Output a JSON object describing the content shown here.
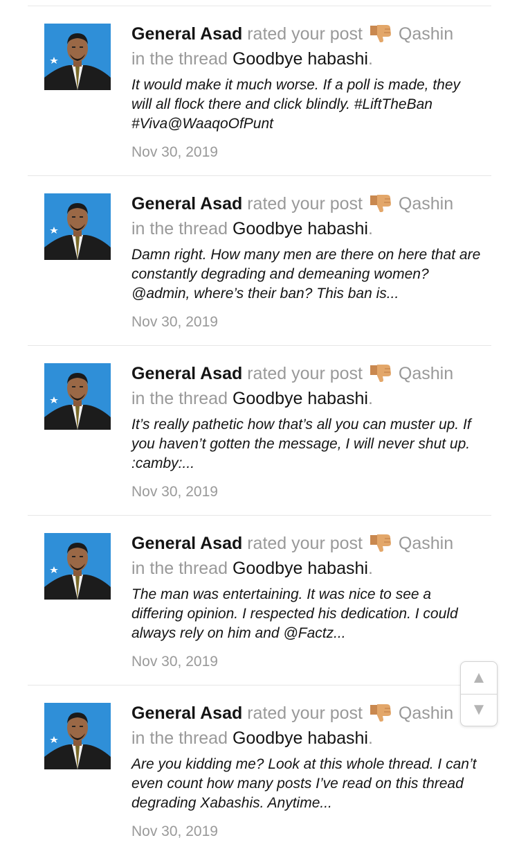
{
  "alerts": [
    {
      "username": "General Asad",
      "action": "rated your post",
      "rating": "Qashin",
      "thread_prefix": "in the thread",
      "thread_title": "Goodbye habashi",
      "period": ".",
      "snippet": "It would make it much worse. If a poll is made, they will all flock there and click blindly. #LiftTheBan #Viva@WaaqoOfPunt",
      "date": "Nov 30, 2019"
    },
    {
      "username": "General Asad",
      "action": "rated your post",
      "rating": "Qashin",
      "thread_prefix": "in the thread",
      "thread_title": "Goodbye habashi",
      "period": ".",
      "snippet": "Damn right. How many men are there on here that are constantly degrading and demeaning women? @admin, where’s their ban? This ban is...",
      "date": "Nov 30, 2019"
    },
    {
      "username": "General Asad",
      "action": "rated your post",
      "rating": "Qashin",
      "thread_prefix": "in the thread",
      "thread_title": "Goodbye habashi",
      "period": ".",
      "snippet": "It’s really pathetic how that’s all you can muster up. If you haven’t gotten the message, I will never shut up. :camby:...",
      "date": "Nov 30, 2019"
    },
    {
      "username": "General Asad",
      "action": "rated your post",
      "rating": "Qashin",
      "thread_prefix": "in the thread",
      "thread_title": "Goodbye habashi",
      "period": ".",
      "snippet": "The man was entertaining. It was nice to see a differing opinion. I respected his dedication. I could always rely on him and @Factz...",
      "date": "Nov 30, 2019"
    },
    {
      "username": "General Asad",
      "action": "rated your post",
      "rating": "Qashin",
      "thread_prefix": "in the thread",
      "thread_title": "Goodbye habashi",
      "period": ".",
      "snippet": "Are you kidding me? Look at this whole thread. I can’t even count how many posts I’ve read on this thread degrading Xabashis. Anytime...",
      "date": "Nov 30, 2019"
    }
  ],
  "icons": {
    "rating": "thumbs-down-icon",
    "scroll_up": "triangle-up-icon",
    "scroll_down": "triangle-down-icon"
  },
  "scroll": {
    "up_glyph": "▲",
    "down_glyph": "▼"
  },
  "colors": {
    "text_dark": "#141414",
    "text_muted": "#999999",
    "divider": "#e6e6e6",
    "avatar_bg": "#2f8fd8",
    "thumb": "#e3a76a"
  }
}
